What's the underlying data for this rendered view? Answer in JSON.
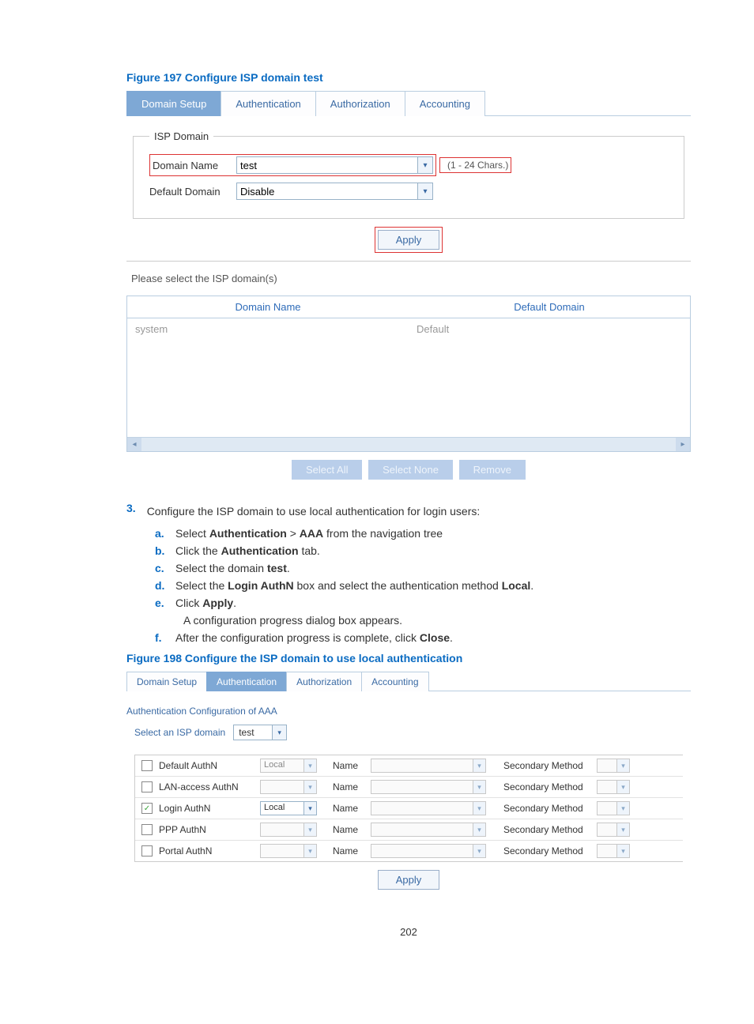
{
  "figure197": {
    "caption": "Figure 197 Configure ISP domain test",
    "tabs": [
      "Domain Setup",
      "Authentication",
      "Authorization",
      "Accounting"
    ],
    "active_tab_index": 0,
    "fieldset_legend": "ISP Domain",
    "domain_name_label": "Domain Name",
    "domain_name_value": "test",
    "domain_hint": "(1 - 24 Chars.)",
    "default_domain_label": "Default Domain",
    "default_domain_value": "Disable",
    "apply_label": "Apply",
    "select_prompt": "Please select the ISP domain(s)",
    "table_headers": [
      "Domain Name",
      "Default Domain"
    ],
    "rows": [
      {
        "name": "system",
        "def": "Default"
      }
    ],
    "actions": [
      "Select All",
      "Select None",
      "Remove"
    ]
  },
  "step3": {
    "num": "3.",
    "title": "Configure the ISP domain to use local authentication for login users:",
    "items": [
      {
        "m": "a.",
        "pre": "Select ",
        "b1": "Authentication",
        "mid": " > ",
        "b2": "AAA",
        "post": " from the navigation tree"
      },
      {
        "m": "b.",
        "pre": "Click the ",
        "b1": "Authentication",
        "post": " tab."
      },
      {
        "m": "c.",
        "pre": "Select the domain ",
        "b1": "test",
        "post": "."
      },
      {
        "m": "d.",
        "pre": "Select the ",
        "b1": "Login AuthN",
        "mid": " box and select the authentication method ",
        "b2": "Local",
        "post": "."
      },
      {
        "m": "e.",
        "pre": "Click ",
        "b1": "Apply",
        "post": ".",
        "extra": "A configuration progress dialog box appears."
      },
      {
        "m": "f.",
        "pre": "After the configuration progress is complete, click ",
        "b1": "Close",
        "post": "."
      }
    ]
  },
  "figure198": {
    "caption": "Figure 198  Configure the ISP domain to use local authentication",
    "tabs": [
      "Domain Setup",
      "Authentication",
      "Authorization",
      "Accounting"
    ],
    "active_tab_index": 1,
    "section_title": "Authentication Configuration of AAA",
    "select_label": "Select an ISP domain",
    "select_value": "test",
    "name_label": "Name",
    "secondary_label": "Secondary Method",
    "rows": [
      {
        "label": "Default AuthN",
        "checked": false,
        "method": "Local",
        "enabled": false
      },
      {
        "label": "LAN-access AuthN",
        "checked": false,
        "method": "",
        "enabled": false
      },
      {
        "label": "Login AuthN",
        "checked": true,
        "method": "Local",
        "enabled": true
      },
      {
        "label": "PPP AuthN",
        "checked": false,
        "method": "",
        "enabled": false
      },
      {
        "label": "Portal AuthN",
        "checked": false,
        "method": "",
        "enabled": false
      }
    ],
    "apply_label": "Apply"
  },
  "page_number": "202"
}
